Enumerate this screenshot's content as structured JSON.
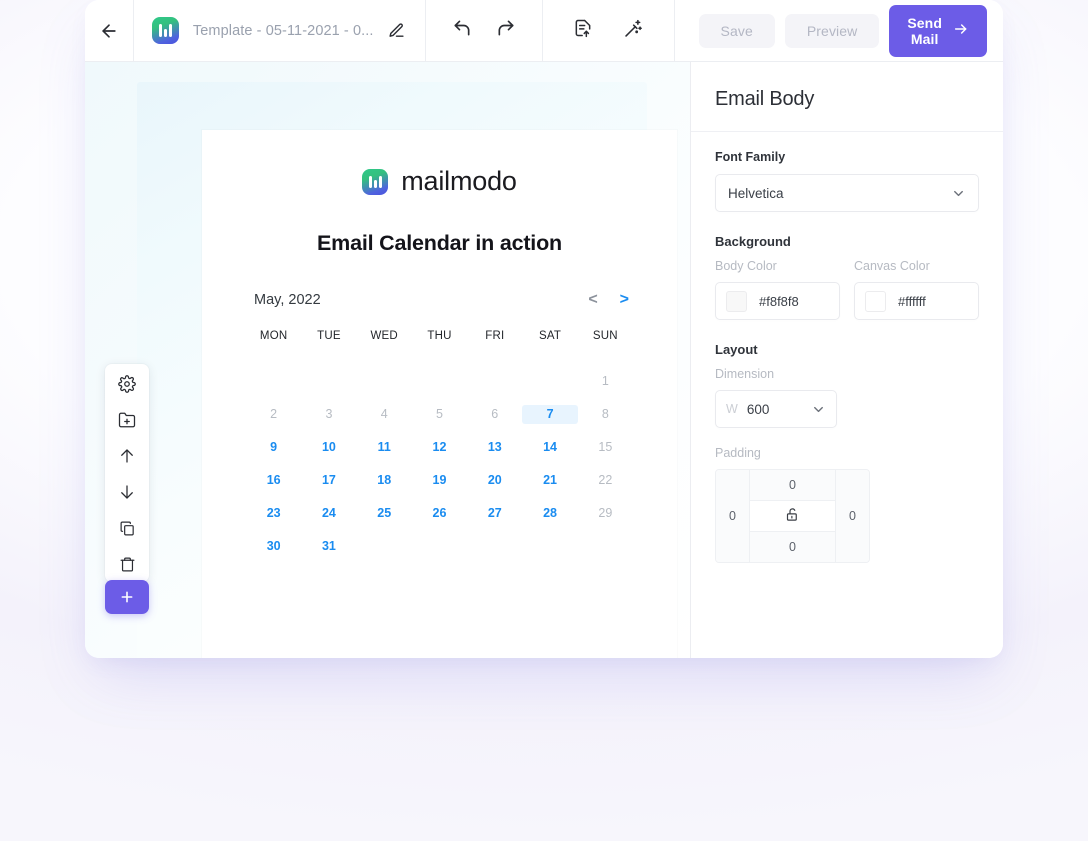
{
  "topbar": {
    "back_icon": "arrow-left-icon",
    "logo_icon": "mailmodo-logo-icon",
    "doc_title": "Template - 05-11-2021 - 0...",
    "edit_icon": "pencil-icon",
    "undo_icon": "undo-icon",
    "redo_icon": "redo-icon",
    "add_block_icon": "document-add-icon",
    "magic_icon": "magic-wand-icon",
    "save_label": "Save",
    "preview_label": "Preview",
    "send_label": "Send Mail",
    "send_arrow_icon": "arrow-right-icon",
    "primary_color": "#6c5ce7"
  },
  "tools": {
    "items": [
      {
        "name": "settings-icon",
        "label": "Settings"
      },
      {
        "name": "folder-add-icon",
        "label": "Save to library"
      },
      {
        "name": "arrow-up-icon",
        "label": "Move up"
      },
      {
        "name": "arrow-down-icon",
        "label": "Move down"
      },
      {
        "name": "duplicate-icon",
        "label": "Duplicate"
      },
      {
        "name": "trash-icon",
        "label": "Delete"
      }
    ],
    "add_label": "+",
    "add_color": "#6c5ce7"
  },
  "email": {
    "brand_name": "mailmodo",
    "brand_icon": "mailmodo-logo-icon",
    "heading": "Email Calendar in action",
    "calendar": {
      "month_label": "May, 2022",
      "prev_label": "<",
      "next_label": ">",
      "prev_color": "#8c929c",
      "next_color": "#1a8cf0",
      "dow": [
        "MON",
        "TUE",
        "WED",
        "THU",
        "FRI",
        "SAT",
        "SUN"
      ],
      "weeks": [
        [
          {
            "d": "",
            "state": "empty"
          },
          {
            "d": "",
            "state": "empty"
          },
          {
            "d": "",
            "state": "empty"
          },
          {
            "d": "",
            "state": "empty"
          },
          {
            "d": "",
            "state": "empty"
          },
          {
            "d": "",
            "state": "empty"
          },
          {
            "d": "1",
            "state": "muted"
          }
        ],
        [
          {
            "d": "2",
            "state": "muted"
          },
          {
            "d": "3",
            "state": "muted"
          },
          {
            "d": "4",
            "state": "muted"
          },
          {
            "d": "5",
            "state": "muted"
          },
          {
            "d": "6",
            "state": "muted"
          },
          {
            "d": "7",
            "state": "today"
          },
          {
            "d": "8",
            "state": "muted"
          }
        ],
        [
          {
            "d": "9",
            "state": "active"
          },
          {
            "d": "10",
            "state": "active"
          },
          {
            "d": "11",
            "state": "active"
          },
          {
            "d": "12",
            "state": "active"
          },
          {
            "d": "13",
            "state": "active"
          },
          {
            "d": "14",
            "state": "active"
          },
          {
            "d": "15",
            "state": "muted"
          }
        ],
        [
          {
            "d": "16",
            "state": "active"
          },
          {
            "d": "17",
            "state": "active"
          },
          {
            "d": "18",
            "state": "active"
          },
          {
            "d": "19",
            "state": "active"
          },
          {
            "d": "20",
            "state": "active"
          },
          {
            "d": "21",
            "state": "active"
          },
          {
            "d": "22",
            "state": "muted"
          }
        ],
        [
          {
            "d": "23",
            "state": "active"
          },
          {
            "d": "24",
            "state": "active"
          },
          {
            "d": "25",
            "state": "active"
          },
          {
            "d": "26",
            "state": "active"
          },
          {
            "d": "27",
            "state": "active"
          },
          {
            "d": "28",
            "state": "active"
          },
          {
            "d": "29",
            "state": "muted"
          }
        ],
        [
          {
            "d": "30",
            "state": "active"
          },
          {
            "d": "31",
            "state": "active"
          },
          {
            "d": "",
            "state": "empty"
          },
          {
            "d": "",
            "state": "empty"
          },
          {
            "d": "",
            "state": "empty"
          },
          {
            "d": "",
            "state": "empty"
          },
          {
            "d": "",
            "state": "empty"
          }
        ]
      ]
    }
  },
  "settings": {
    "title": "Email Body",
    "font_family_label": "Font Family",
    "font_family_value": "Helvetica",
    "background_label": "Background",
    "body_color_label": "Body Color",
    "body_color_value": "#f8f8f8",
    "canvas_color_label": "Canvas Color",
    "canvas_color_value": "#ffffff",
    "layout_label": "Layout",
    "dimension_label": "Dimension",
    "dimension_unit": "W",
    "dimension_value": "600",
    "padding_label": "Padding",
    "padding_top": "0",
    "padding_right": "0",
    "padding_bottom": "0",
    "padding_left": "0",
    "padding_lock_icon": "unlock-icon",
    "chevron_icon": "chevron-down-icon"
  }
}
